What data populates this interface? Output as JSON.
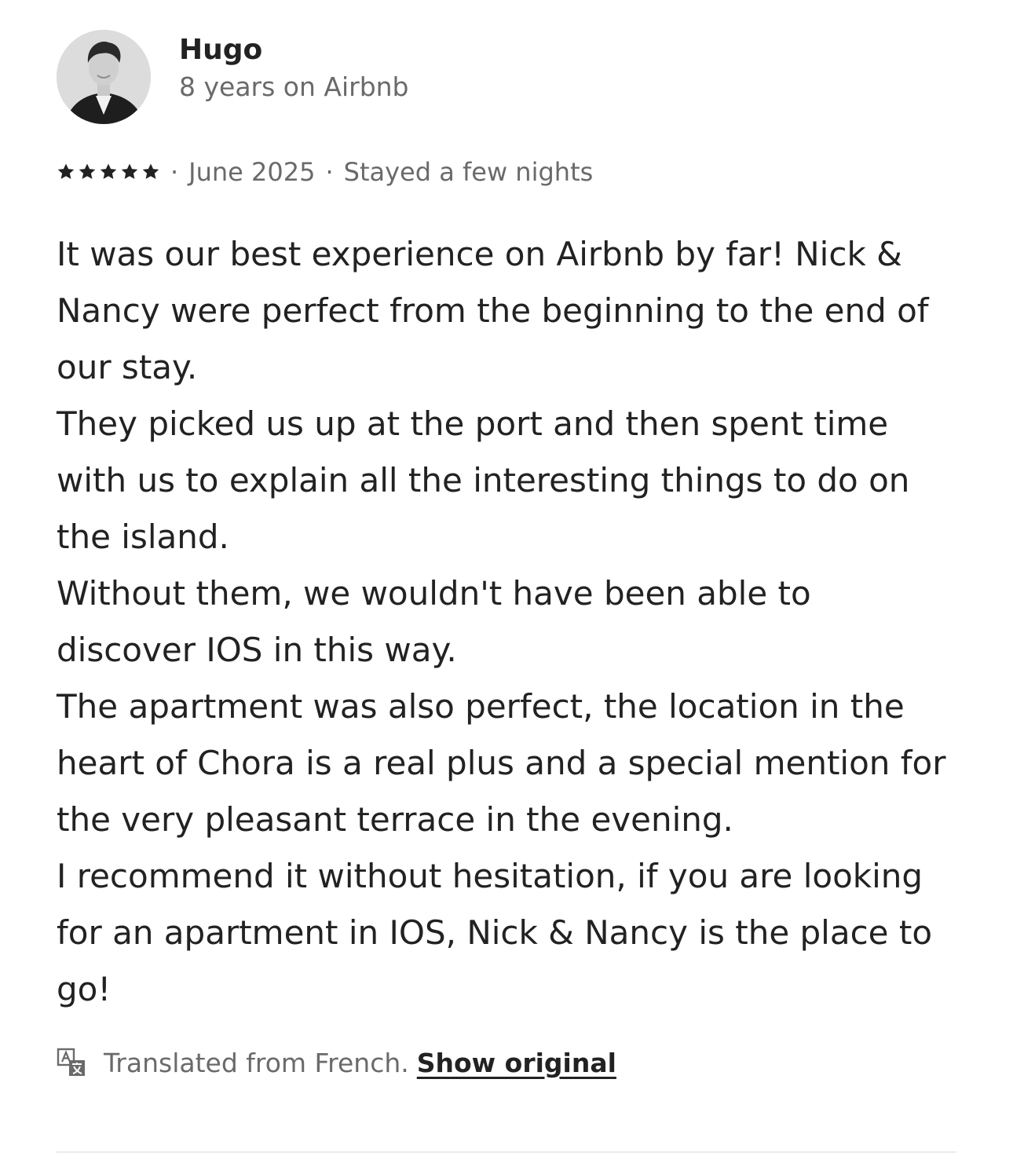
{
  "reviewer": {
    "name": "Hugo",
    "tenure": "8 years on Airbnb",
    "avatar_icon": "user-avatar"
  },
  "review": {
    "rating": 5,
    "date": "June 2025",
    "stay": "Stayed a few nights",
    "separator": "·",
    "paragraphs": [
      "It was our best experience on Airbnb by far! Nick & Nancy were perfect from the beginning to the end of our stay.",
      "They picked us up at the port and then spent time with us to explain all the interesting things to do on the island.",
      "Without them, we wouldn't have been able to discover IOS in this way.",
      "The apartment was also perfect, the location in the heart of Chora is a real plus and a special mention for the very pleasant terrace in the evening.",
      "I recommend it without hesitation, if you are looking for an apartment in IOS, Nick & Nancy is the place to go!"
    ]
  },
  "translation": {
    "icon": "translate-icon",
    "note": "Translated from French.",
    "link_label": "Show original"
  },
  "colors": {
    "primary_text": "#222222",
    "secondary_text": "#6a6a6a",
    "divider": "#ebebeb"
  }
}
